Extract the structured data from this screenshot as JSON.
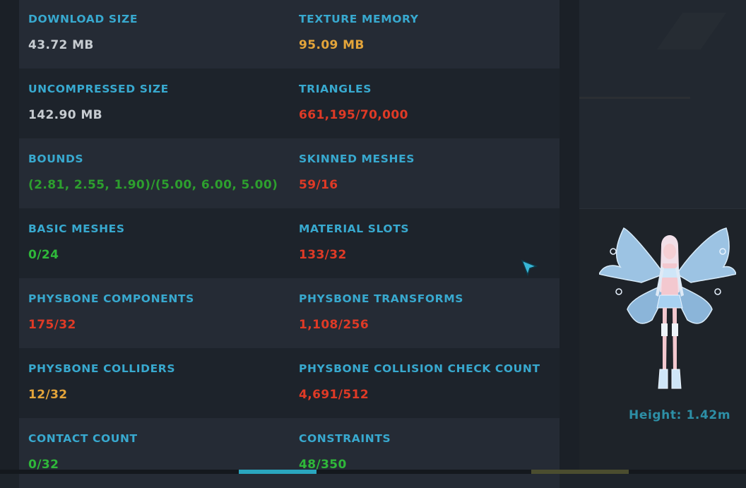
{
  "stats": {
    "download_size": {
      "label": "DOWNLOAD SIZE",
      "value": "43.72 MB"
    },
    "texture_memory": {
      "label": "TEXTURE MEMORY",
      "value": "95.09 MB"
    },
    "uncompressed_size": {
      "label": "UNCOMPRESSED SIZE",
      "value": "142.90 MB"
    },
    "triangles": {
      "label": "TRIANGLES",
      "value": "661,195/70,000"
    },
    "bounds": {
      "label": "BOUNDS",
      "value": "(2.81, 2.55, 1.90)/(5.00, 6.00, 5.00)"
    },
    "skinned_meshes": {
      "label": "SKINNED MESHES",
      "value": "59/16"
    },
    "basic_meshes": {
      "label": "BASIC MESHES",
      "value": "0/24"
    },
    "material_slots": {
      "label": "MATERIAL SLOTS",
      "value": "133/32"
    },
    "physbone_components": {
      "label": "PHYSBONE COMPONENTS",
      "value": "175/32"
    },
    "physbone_transforms": {
      "label": "PHYSBONE TRANSFORMS",
      "value": "1,108/256"
    },
    "physbone_colliders": {
      "label": "PHYSBONE COLLIDERS",
      "value": "12/32"
    },
    "physbone_collision_check_count": {
      "label": "PHYSBONE COLLISION CHECK COUNT",
      "value": "4,691/512"
    },
    "contact_count": {
      "label": "CONTACT COUNT",
      "value": "0/32"
    },
    "constraints": {
      "label": "CONSTRAINTS",
      "value": "48/350"
    }
  },
  "preview": {
    "height_text": "Height: 1.42m"
  },
  "colors": {
    "label": "#38a9cf",
    "value_neutral": "#c7ccd1",
    "value_warning": "#e3a43a",
    "value_bad": "#df3a26",
    "value_good": "#2fb83a"
  },
  "icons": {
    "cursor": "arrow-cursor-icon",
    "avatar": "fairy-avatar-preview"
  }
}
